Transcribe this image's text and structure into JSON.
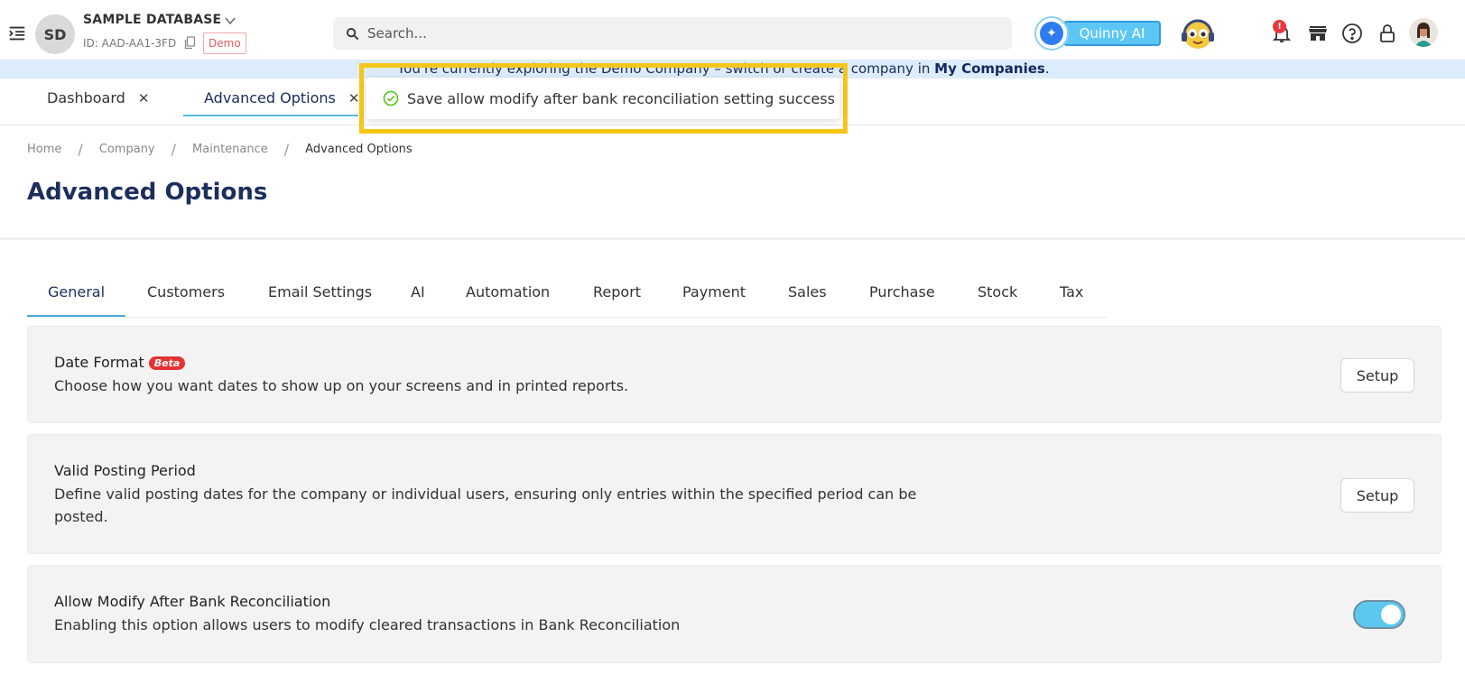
{
  "header": {
    "avatar_initials": "SD",
    "db_name": "SAMPLE DATABASE",
    "db_id": "ID: AAD-AA1-3FD",
    "demo_badge": "Demo",
    "search_placeholder": "Search...",
    "quinny_label": "Quinny AI",
    "notification_count": "!"
  },
  "banner": {
    "text": "You're currently exploring the Demo Company – switch or create a company in ",
    "link": "My Companies",
    "suffix": "."
  },
  "doc_tabs": [
    {
      "label": "Dashboard"
    },
    {
      "label": "Advanced Options"
    }
  ],
  "toast": {
    "message": "Save allow modify after bank reconciliation setting success"
  },
  "breadcrumb": [
    "Home",
    "Company",
    "Maintenance",
    "Advanced Options"
  ],
  "page_title": "Advanced Options",
  "settings_tabs": [
    "General",
    "Customers",
    "Email Settings",
    "AI",
    "Automation",
    "Report",
    "Payment",
    "Sales",
    "Purchase",
    "Stock",
    "Tax"
  ],
  "active_settings_tab": "General",
  "cards": [
    {
      "title": "Date Format",
      "badge": "Beta",
      "description": "Choose how you want dates to show up on your screens and in printed reports.",
      "action": "Setup"
    },
    {
      "title": "Valid Posting Period",
      "description_line1": "Define valid posting dates for the company or individual users, ensuring only entries within the specified period can be",
      "description_line2": "posted.",
      "action": "Setup"
    },
    {
      "title": "Allow Modify After Bank Reconciliation",
      "description": "Enabling this option allows users to modify cleared transactions in Bank Reconciliation",
      "toggle_on": true
    }
  ],
  "colors": {
    "accent": "#5ab8e0",
    "title": "#1c2e5e",
    "toast_frame": "#f5c518",
    "success": "#52c41a",
    "banner_bg": "#dcecfb"
  }
}
